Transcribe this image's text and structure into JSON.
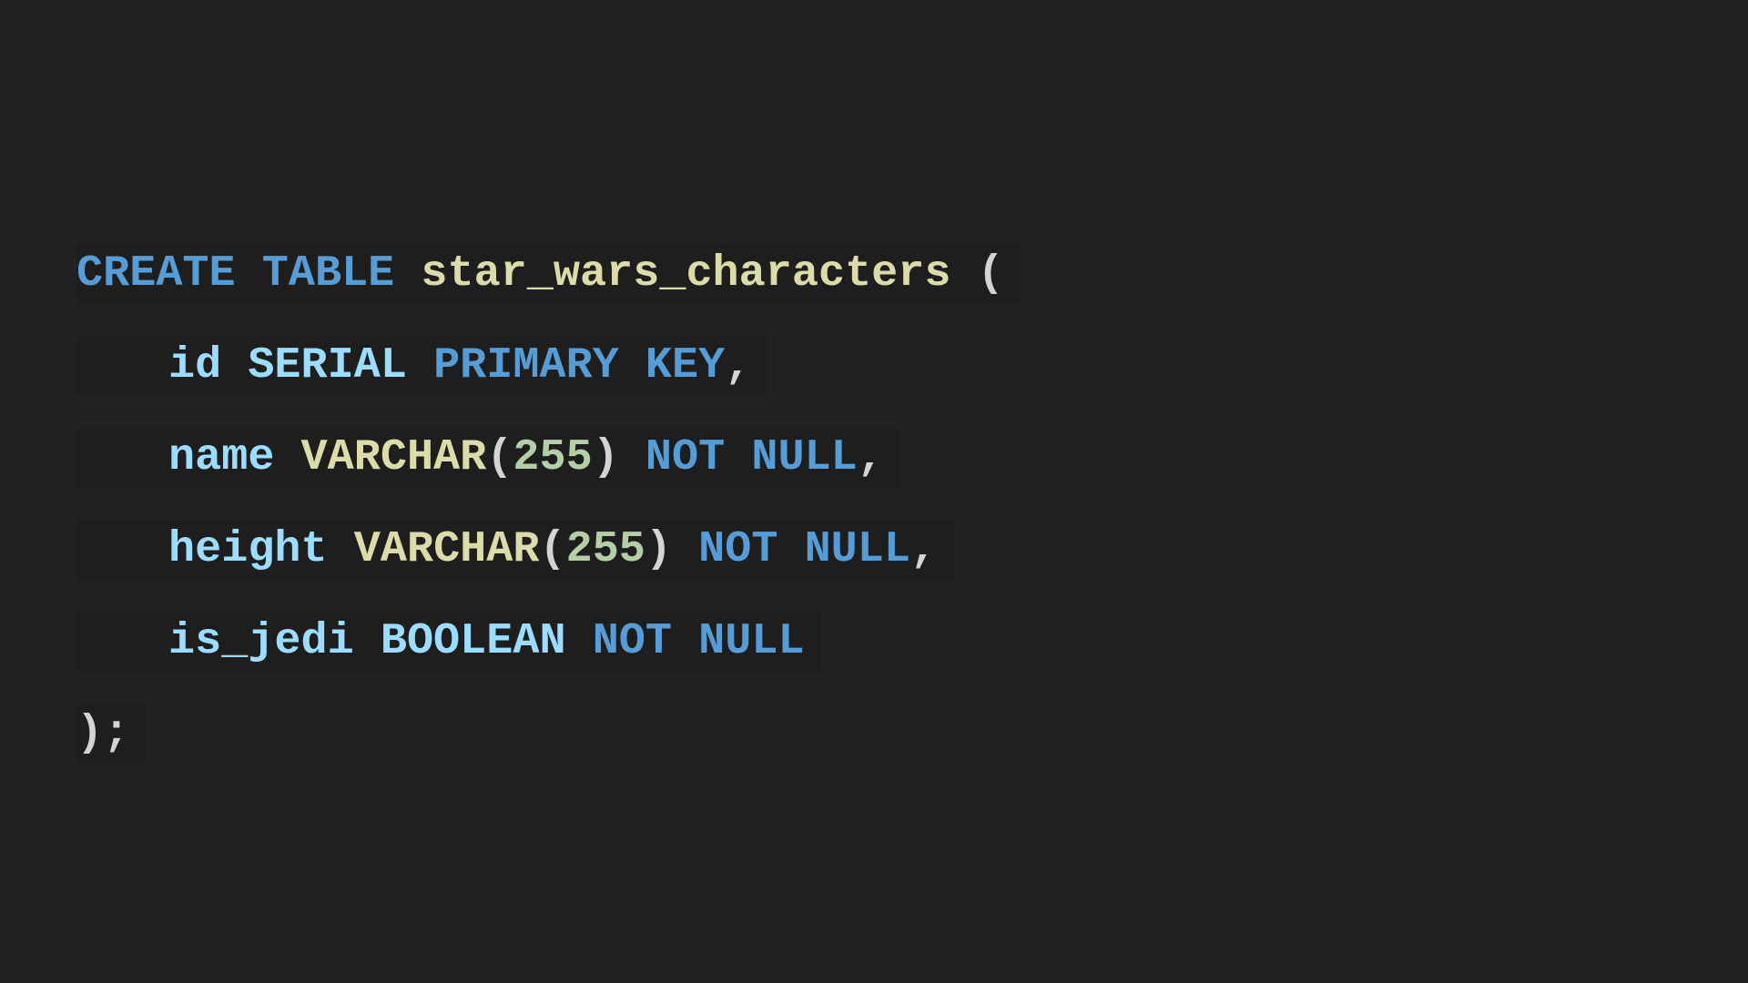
{
  "colors": {
    "background": "#222222",
    "line_highlight": "#1e1e1e",
    "keyword": "#569cd6",
    "identifier": "#dcdcaa",
    "field": "#9cdcfe",
    "number": "#b5cea8",
    "punctuation": "#d4d4d4"
  },
  "code": {
    "line1": {
      "create": "CREATE",
      "table": "TABLE",
      "table_name": "star_wars_characters",
      "open_paren": "("
    },
    "line2": {
      "column": "id",
      "type": "SERIAL",
      "primary": "PRIMARY",
      "key": "KEY",
      "comma": ","
    },
    "line3": {
      "column": "name",
      "type": "VARCHAR",
      "open": "(",
      "length": "255",
      "close": ")",
      "not": "NOT",
      "null": "NULL",
      "comma": ","
    },
    "line4": {
      "column": "height",
      "type": "VARCHAR",
      "open": "(",
      "length": "255",
      "close": ")",
      "not": "NOT",
      "null": "NULL",
      "comma": ","
    },
    "line5": {
      "column": "is_jedi",
      "type": "BOOLEAN",
      "not": "NOT",
      "null": "NULL"
    },
    "line6": {
      "close": ");"
    }
  }
}
